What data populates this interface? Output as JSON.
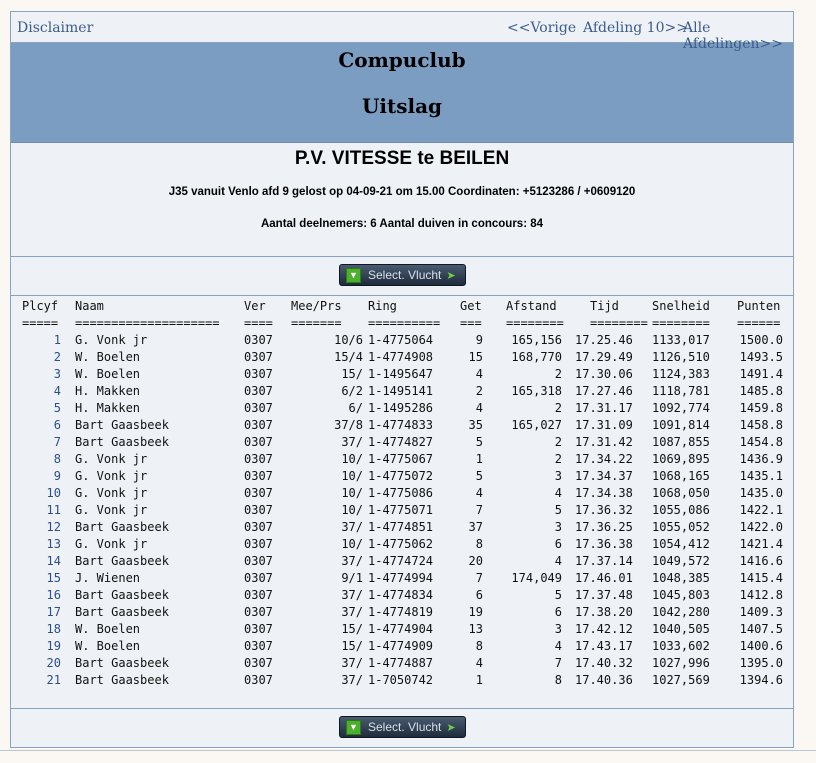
{
  "nav": {
    "disclaimer": "Disclaimer",
    "prev": "<<Vorige",
    "afdeling": "Afdeling 10>>",
    "all": "Alle Afdelingen>>"
  },
  "banner": {
    "title": "Compuclub",
    "subtitle": "Uitslag"
  },
  "info": {
    "club": "P.V. VITESSE te BEILEN",
    "race": "J35 vanuit Venlo afd 9 gelost op 04-09-21 om 15.00 Coordinaten: +5123286 / +0609120",
    "count": "Aantal deelnemers: 6 Aantal duiven in concours: 84"
  },
  "button": {
    "label": "Select. Vlucht"
  },
  "table": {
    "headers": [
      "Plcyf",
      "Naam",
      "Ver",
      "Mee/Prs",
      "Ring",
      "Get",
      "Afstand",
      "Tijd",
      "Snelheid",
      "Punten"
    ],
    "underline": [
      "=====",
      "====================",
      "====",
      "=======",
      "==========",
      "===",
      "========",
      "========",
      "========",
      "======"
    ],
    "rows": [
      [
        "1",
        "G. Vonk jr",
        "0307",
        "10/6",
        "1-4775064",
        "9",
        "165,156",
        "17.25.46",
        "1133,017",
        "1500.0"
      ],
      [
        "2",
        "W. Boelen",
        "0307",
        "15/4",
        "1-4774908",
        "15",
        "168,770",
        "17.29.49",
        "1126,510",
        "1493.5"
      ],
      [
        "3",
        "W. Boelen",
        "0307",
        "15/",
        "1-1495647",
        "4",
        "2",
        "17.30.06",
        "1124,383",
        "1491.4"
      ],
      [
        "4",
        "H. Makken",
        "0307",
        "6/2",
        "1-1495141",
        "2",
        "165,318",
        "17.27.46",
        "1118,781",
        "1485.8"
      ],
      [
        "5",
        "H. Makken",
        "0307",
        "6/",
        "1-1495286",
        "4",
        "2",
        "17.31.17",
        "1092,774",
        "1459.8"
      ],
      [
        "6",
        "Bart Gaasbeek",
        "0307",
        "37/8",
        "1-4774833",
        "35",
        "165,027",
        "17.31.09",
        "1091,814",
        "1458.8"
      ],
      [
        "7",
        "Bart Gaasbeek",
        "0307",
        "37/",
        "1-4774827",
        "5",
        "2",
        "17.31.42",
        "1087,855",
        "1454.8"
      ],
      [
        "8",
        "G. Vonk jr",
        "0307",
        "10/",
        "1-4775067",
        "1",
        "2",
        "17.34.22",
        "1069,895",
        "1436.9"
      ],
      [
        "9",
        "G. Vonk jr",
        "0307",
        "10/",
        "1-4775072",
        "5",
        "3",
        "17.34.37",
        "1068,165",
        "1435.1"
      ],
      [
        "10",
        "G. Vonk jr",
        "0307",
        "10/",
        "1-4775086",
        "4",
        "4",
        "17.34.38",
        "1068,050",
        "1435.0"
      ],
      [
        "11",
        "G. Vonk jr",
        "0307",
        "10/",
        "1-4775071",
        "7",
        "5",
        "17.36.32",
        "1055,086",
        "1422.1"
      ],
      [
        "12",
        "Bart Gaasbeek",
        "0307",
        "37/",
        "1-4774851",
        "37",
        "3",
        "17.36.25",
        "1055,052",
        "1422.0"
      ],
      [
        "13",
        "G. Vonk jr",
        "0307",
        "10/",
        "1-4775062",
        "8",
        "6",
        "17.36.38",
        "1054,412",
        "1421.4"
      ],
      [
        "14",
        "Bart Gaasbeek",
        "0307",
        "37/",
        "1-4774724",
        "20",
        "4",
        "17.37.14",
        "1049,572",
        "1416.6"
      ],
      [
        "15",
        "J. Wienen",
        "0307",
        "9/1",
        "1-4774994",
        "7",
        "174,049",
        "17.46.01",
        "1048,385",
        "1415.4"
      ],
      [
        "16",
        "Bart Gaasbeek",
        "0307",
        "37/",
        "1-4774834",
        "6",
        "5",
        "17.37.48",
        "1045,803",
        "1412.8"
      ],
      [
        "17",
        "Bart Gaasbeek",
        "0307",
        "37/",
        "1-4774819",
        "19",
        "6",
        "17.38.20",
        "1042,280",
        "1409.3"
      ],
      [
        "18",
        "W. Boelen",
        "0307",
        "15/",
        "1-4774904",
        "13",
        "3",
        "17.42.12",
        "1040,505",
        "1407.5"
      ],
      [
        "19",
        "W. Boelen",
        "0307",
        "15/",
        "1-4774909",
        "8",
        "4",
        "17.43.17",
        "1033,602",
        "1400.6"
      ],
      [
        "20",
        "Bart Gaasbeek",
        "0307",
        "37/",
        "1-4774887",
        "4",
        "7",
        "17.40.32",
        "1027,996",
        "1395.0"
      ],
      [
        "21",
        "Bart Gaasbeek",
        "0307",
        "37/",
        "1-7050742",
        "1",
        "8",
        "17.40.36",
        "1027,569",
        "1394.6"
      ]
    ]
  }
}
